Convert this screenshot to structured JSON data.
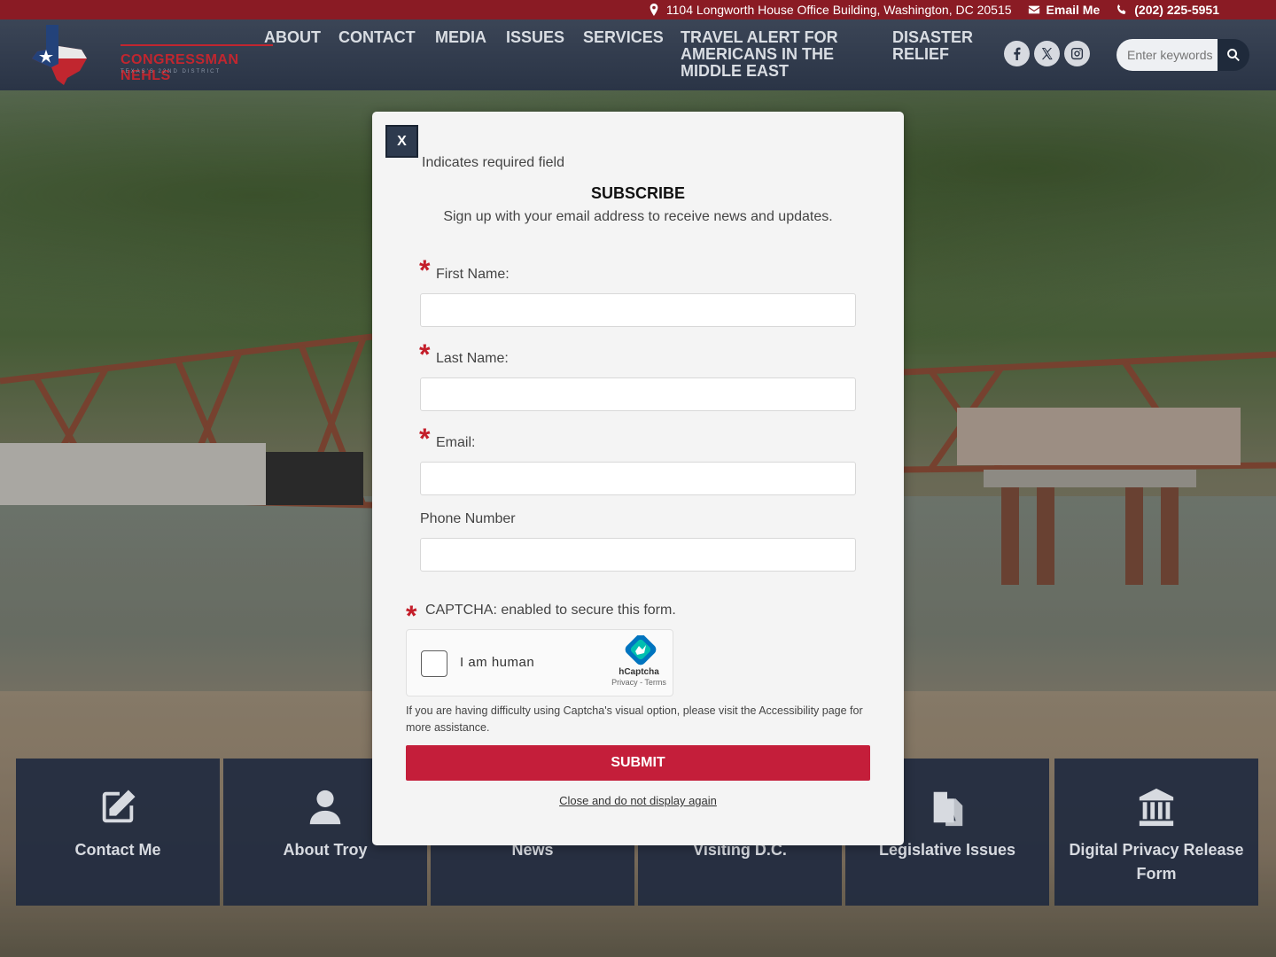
{
  "topbar": {
    "address": "1104 Longworth House Office Building, Washington, DC 20515",
    "email_label": "Email Me",
    "phone": "(202) 225-5951"
  },
  "header": {
    "logo_text": "CONGRESSMAN NEHLS",
    "logo_subtext": "TEXAS'S 22ND DISTRICT",
    "nav": {
      "about": "ABOUT",
      "contact": "CONTACT",
      "media": "MEDIA",
      "issues": "ISSUES",
      "services": "SERVICES",
      "travel": "TRAVEL ALERT FOR AMERICANS IN THE MIDDLE EAST",
      "disaster": "DISASTER RELIEF"
    },
    "social_icons": [
      "facebook-icon",
      "x-icon",
      "instagram-icon"
    ],
    "search_placeholder": "Enter keywords"
  },
  "modal": {
    "close_label": "X",
    "required_note": "Indicates required field",
    "title": "SUBSCRIBE",
    "description": "Sign up with your email address to receive news and updates.",
    "fields": {
      "first_name": "First Name:",
      "last_name": "Last Name:",
      "email": "Email:",
      "phone": "Phone Number"
    },
    "captcha_label": "CAPTCHA: enabled to secure this form.",
    "captcha_checkbox": "I am human",
    "captcha_brand": "hCaptcha",
    "captcha_terms": "Privacy - Terms",
    "help_text": "If you are having difficulty using Captcha's visual option, please visit the Accessibility page for more assistance.",
    "submit_label": "SUBMIT",
    "dismiss_label": "Close and do not display again"
  },
  "tiles": [
    {
      "label": "Contact Me",
      "icon": "edit-icon"
    },
    {
      "label": "About Troy",
      "icon": "user-icon"
    },
    {
      "label": "News",
      "icon": "newspaper-icon"
    },
    {
      "label": "Visiting D.C.",
      "icon": "capitol-icon"
    },
    {
      "label": "Legislative Issues",
      "icon": "clipboard-icon"
    },
    {
      "label": "Digital Privacy Release Form",
      "icon": "institution-icon"
    }
  ],
  "colors": {
    "topbar": "#8a1b24",
    "header": "#2a3446",
    "accent_red": "#c41e3a",
    "tile_bg": "#212b3f"
  }
}
